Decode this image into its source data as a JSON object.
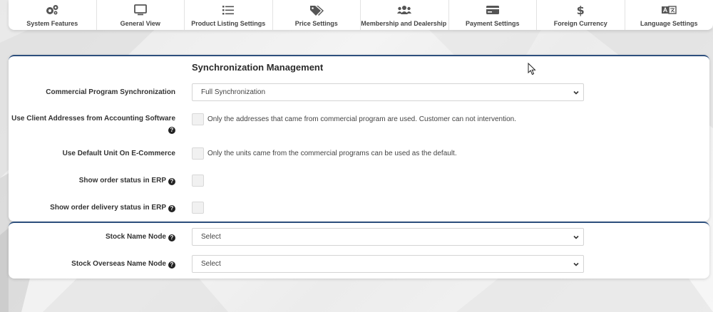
{
  "tabs": [
    {
      "label": "System Features",
      "icon": "cogs-icon"
    },
    {
      "label": "General View",
      "icon": "monitor-icon"
    },
    {
      "label": "Product Listing Settings",
      "icon": "list-icon"
    },
    {
      "label": "Price Settings",
      "icon": "tags-icon"
    },
    {
      "label": "Membership and Dealership Se",
      "icon": "users-icon"
    },
    {
      "label": "Payment Settings",
      "icon": "credit-card-icon"
    },
    {
      "label": "Foreign Currency",
      "icon": "dollar-icon"
    },
    {
      "label": "Language Settings",
      "icon": "language-icon"
    }
  ],
  "sync": {
    "title": "Synchronization Management",
    "commercial_sync": {
      "label": "Commercial Program Synchronization",
      "value": "Full Synchronization"
    },
    "client_addresses": {
      "label": "Use Client Addresses from Accounting Software",
      "hint": "Only the addresses that came from commercial program are used. Customer can not intervention."
    },
    "default_unit": {
      "label": "Use Default Unit On E-Commerce",
      "hint": "Only the units came from the commercial programs can be used as the default."
    },
    "order_status": {
      "label": "Show order status in ERP"
    },
    "delivery_status": {
      "label": "Show order delivery status in ERP"
    }
  },
  "stock": {
    "name_node": {
      "label": "Stock Name Node",
      "value": "Select"
    },
    "overseas_node": {
      "label": "Stock Overseas Name Node",
      "value": "Select"
    }
  },
  "help_glyph": "?"
}
